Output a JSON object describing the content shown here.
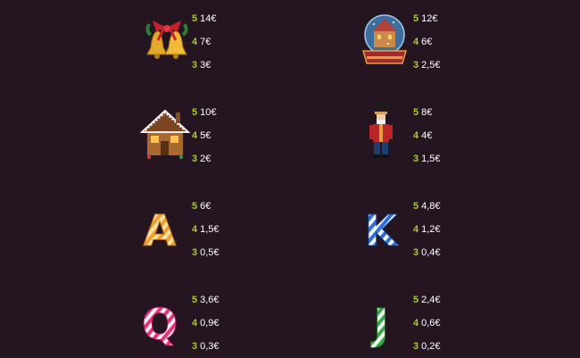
{
  "paytable": {
    "symbols": [
      {
        "icon": "bell-icon",
        "pays": [
          {
            "count": "5",
            "value": "14€"
          },
          {
            "count": "4",
            "value": "7€"
          },
          {
            "count": "3",
            "value": "3€"
          }
        ]
      },
      {
        "icon": "snow-globe-icon",
        "pays": [
          {
            "count": "5",
            "value": "12€"
          },
          {
            "count": "4",
            "value": "6€"
          },
          {
            "count": "3",
            "value": "2,5€"
          }
        ]
      },
      {
        "icon": "gingerbread-house-icon",
        "pays": [
          {
            "count": "5",
            "value": "10€"
          },
          {
            "count": "4",
            "value": "5€"
          },
          {
            "count": "3",
            "value": "2€"
          }
        ]
      },
      {
        "icon": "nutcracker-icon",
        "pays": [
          {
            "count": "5",
            "value": "8€"
          },
          {
            "count": "4",
            "value": "4€"
          },
          {
            "count": "3",
            "value": "1,5€"
          }
        ]
      },
      {
        "icon": "candy-letter-a-icon",
        "letter": "A",
        "pays": [
          {
            "count": "5",
            "value": "6€"
          },
          {
            "count": "4",
            "value": "1,5€"
          },
          {
            "count": "3",
            "value": "0,5€"
          }
        ]
      },
      {
        "icon": "candy-letter-k-icon",
        "letter": "K",
        "pays": [
          {
            "count": "5",
            "value": "4,8€"
          },
          {
            "count": "4",
            "value": "1,2€"
          },
          {
            "count": "3",
            "value": "0,4€"
          }
        ]
      },
      {
        "icon": "candy-letter-q-icon",
        "letter": "Q",
        "pays": [
          {
            "count": "5",
            "value": "3,6€"
          },
          {
            "count": "4",
            "value": "0,9€"
          },
          {
            "count": "3",
            "value": "0,3€"
          }
        ]
      },
      {
        "icon": "candy-letter-j-icon",
        "letter": "J",
        "pays": [
          {
            "count": "5",
            "value": "2,4€"
          },
          {
            "count": "4",
            "value": "0,6€"
          },
          {
            "count": "3",
            "value": "0,2€"
          }
        ]
      }
    ]
  },
  "colors": {
    "background": "#241520",
    "count": "#a6cc2e",
    "value": "#ffffff"
  }
}
